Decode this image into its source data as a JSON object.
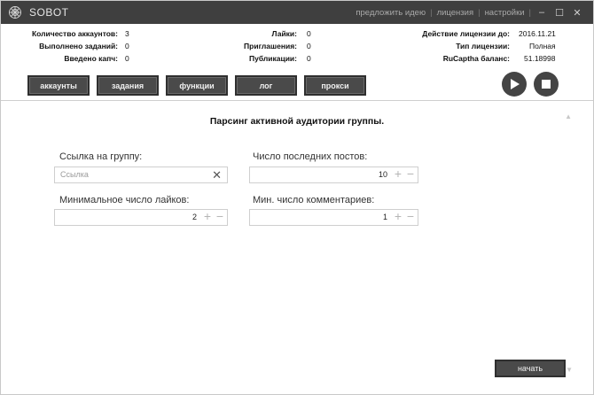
{
  "app": {
    "title": "SOBOT"
  },
  "titlebar": {
    "menu": [
      "предложить идею",
      "лицензия",
      "настройки"
    ],
    "minimize": "–",
    "maximize": "☐",
    "close": "✕"
  },
  "stats": {
    "col1": [
      {
        "label": "Количество аккаунтов:",
        "value": "3"
      },
      {
        "label": "Выполнено заданий:",
        "value": "0"
      },
      {
        "label": "Введено капч:",
        "value": "0"
      }
    ],
    "col2": [
      {
        "label": "Лайки:",
        "value": "0"
      },
      {
        "label": "Приглашения:",
        "value": "0"
      },
      {
        "label": "Публикации:",
        "value": "0"
      }
    ],
    "col3": [
      {
        "label": "Действие лицензии до:",
        "value": "2016.11.21"
      },
      {
        "label": "Тип лицензии:",
        "value": "Полная"
      },
      {
        "label": "RuCaptha баланс:",
        "value": "51.18998"
      }
    ]
  },
  "nav": [
    "аккаунты",
    "задания",
    "функции",
    "лог",
    "прокси"
  ],
  "section": {
    "title": "Парсинг активной аудитории группы."
  },
  "form": {
    "group_link": {
      "label": "Ссылка на группу:",
      "placeholder": "Ссылка"
    },
    "recent_posts": {
      "label": "Число последних постов:",
      "value": "10"
    },
    "min_likes": {
      "label": "Минимальное число лайков:",
      "value": "2"
    },
    "min_comments": {
      "label": "Мин. число комментариев:",
      "value": "1"
    }
  },
  "actions": {
    "start": "начать"
  },
  "colors": {
    "titlebar": "#3f3f3f",
    "button": "#4a4a4a",
    "field_border": "#cfcfcf"
  },
  "icons": {
    "logo": "web-logo-icon",
    "play": "play-icon",
    "stop": "stop-icon",
    "clear": "close-icon",
    "plus": "plus-icon",
    "minus": "minus-icon"
  }
}
